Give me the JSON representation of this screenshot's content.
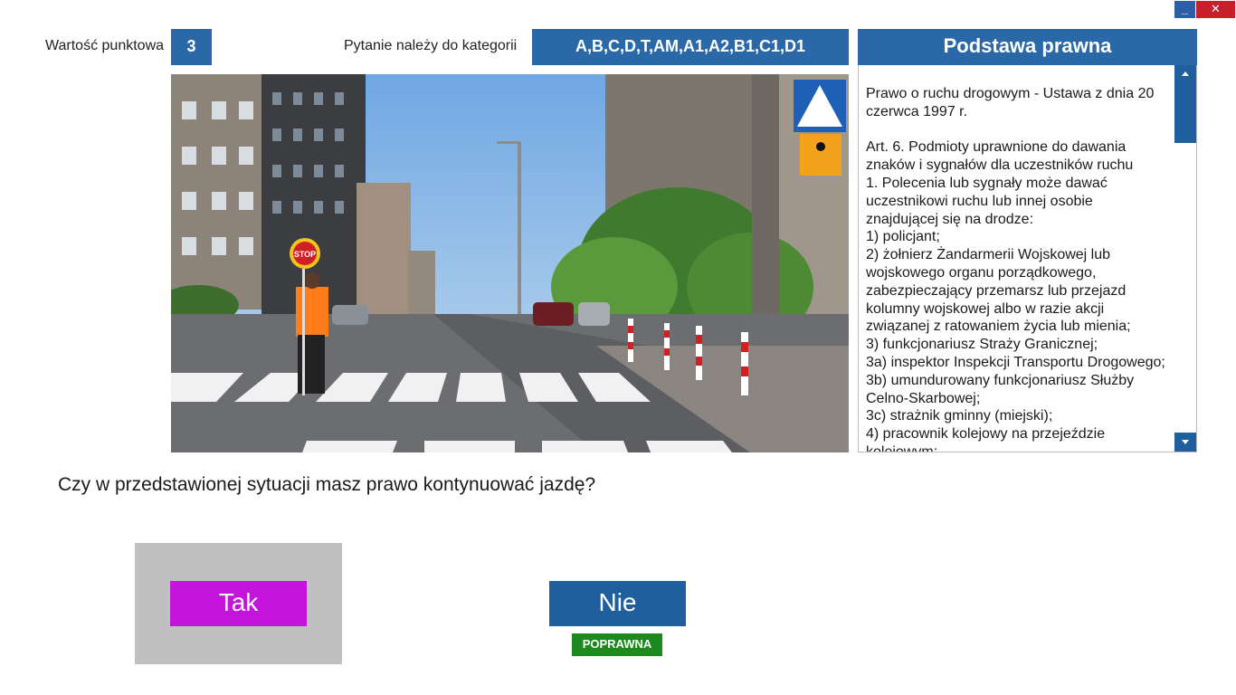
{
  "window": {
    "minimize_label": "_",
    "close_label": "✕"
  },
  "header": {
    "points_label": "Wartość punktowa",
    "points_value": "3",
    "category_label": "Pytanie należy do kategorii",
    "categories": "A,B,C,D,T,AM,A1,A2,B1,C1,D1"
  },
  "scene": {
    "stop_sign_text": "STOP"
  },
  "legal": {
    "title": "Podstawa prawna",
    "lines": [
      "Prawo o ruchu drogowym - Ustawa z dnia 20",
      "czerwca 1997 r.",
      "",
      "Art. 6. Podmioty uprawnione do dawania",
      "znaków i sygnałów dla uczestników ruchu",
      "1. Polecenia lub sygnały może dawać",
      "uczestnikowi ruchu lub innej osobie",
      "znajdującej się na drodze:",
      "1) policjant;",
      "2) żołnierz Żandarmerii Wojskowej lub",
      "wojskowego organu porządkowego,",
      "zabezpieczający przemarsz lub przejazd",
      "kolumny wojskowej albo w razie akcji",
      "związanej z ratowaniem życia lub mienia;",
      "3) funkcjonariusz Straży Granicznej;",
      "3a) inspektor Inspekcji Transportu Drogowego;",
      "3b) umundurowany funkcjonariusz Służby",
      "Celno-Skarbowej;",
      "3c) strażnik gminny (miejski);",
      "4) pracownik kolejowy na przejeździe",
      "kolejowym;"
    ]
  },
  "question": {
    "text": "Czy w przedstawionej sytuacji masz prawo kontynuować jazdę?"
  },
  "answers": {
    "yes_label": "Tak",
    "no_label": "Nie",
    "correct_badge": "POPRAWNA",
    "selected": "yes",
    "correct": "no"
  },
  "colors": {
    "accent_blue": "#2a68a8",
    "selected_answer": "#c214db",
    "correct_green": "#1c8a1c",
    "close_red": "#c8202a"
  }
}
